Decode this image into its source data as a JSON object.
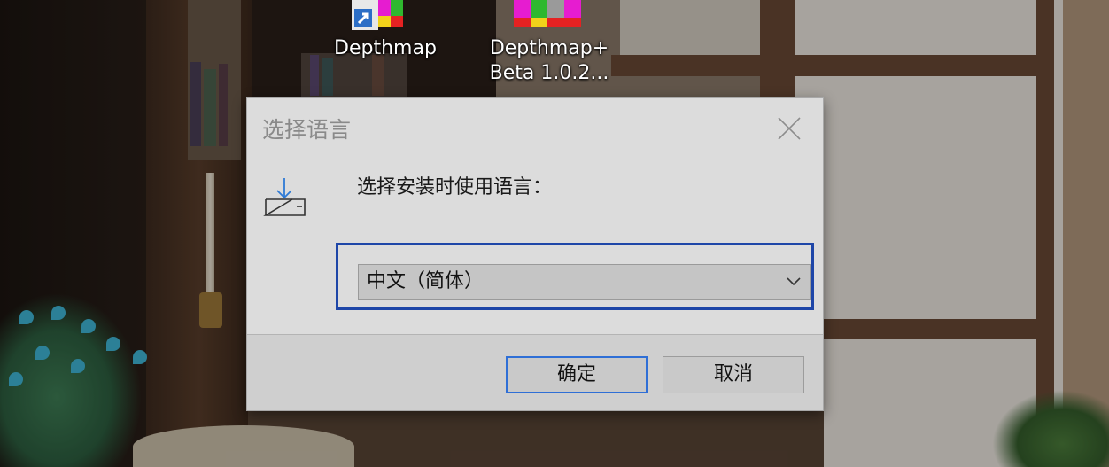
{
  "desktop": {
    "icons": [
      {
        "label": "Depthmap",
        "name": "depthmap-shortcut"
      },
      {
        "label": "Depthmap+\nBeta 1.0.2...",
        "label_line1": "Depthmap+",
        "label_line2": "Beta 1.0.2...",
        "name": "depthmap-beta-shortcut"
      }
    ]
  },
  "dialog": {
    "title": "选择语言",
    "prompt": "选择安装时使用语言：",
    "language_select": {
      "value": "中文（简体）"
    },
    "ok_label": "确定",
    "cancel_label": "取消",
    "icons": {
      "close": "close-icon",
      "setup": "install-tray-icon",
      "dropdown": "chevron-down-icon"
    }
  },
  "colors": {
    "focus_border": "#1e46a8",
    "default_button_border": "#2f6fd6",
    "dialog_bg": "#dcdcdc",
    "footer_bg": "#cfcfcf"
  }
}
